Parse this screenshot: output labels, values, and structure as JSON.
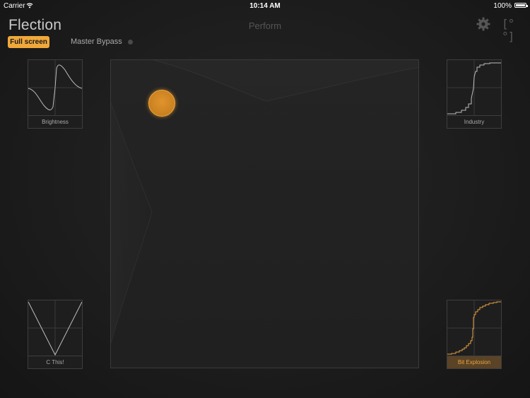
{
  "status_bar": {
    "carrier": "Carrier",
    "time": "10:14 AM",
    "battery": "100%"
  },
  "header": {
    "logo": "Flection",
    "title": "Perform",
    "fullscreen_label": "Full screen",
    "bypass_label": "Master Bypass",
    "bypass_text": "[°°]"
  },
  "effects": [
    {
      "label": "Brightness",
      "curve": "ringing-step"
    },
    {
      "label": "Industry",
      "curve": "stair-step"
    },
    {
      "label": "C This!",
      "curve": "v-shape"
    },
    {
      "label": "Bit Explosion",
      "curve": "quantized-s-curve",
      "active": true
    }
  ],
  "colors": {
    "accent": "#f0a83a",
    "background": "#1c1c1c",
    "panel_border": "#3e3e3e"
  },
  "icons": [
    "wifi-icon",
    "battery-icon",
    "gear-icon",
    "bracket-icon"
  ]
}
